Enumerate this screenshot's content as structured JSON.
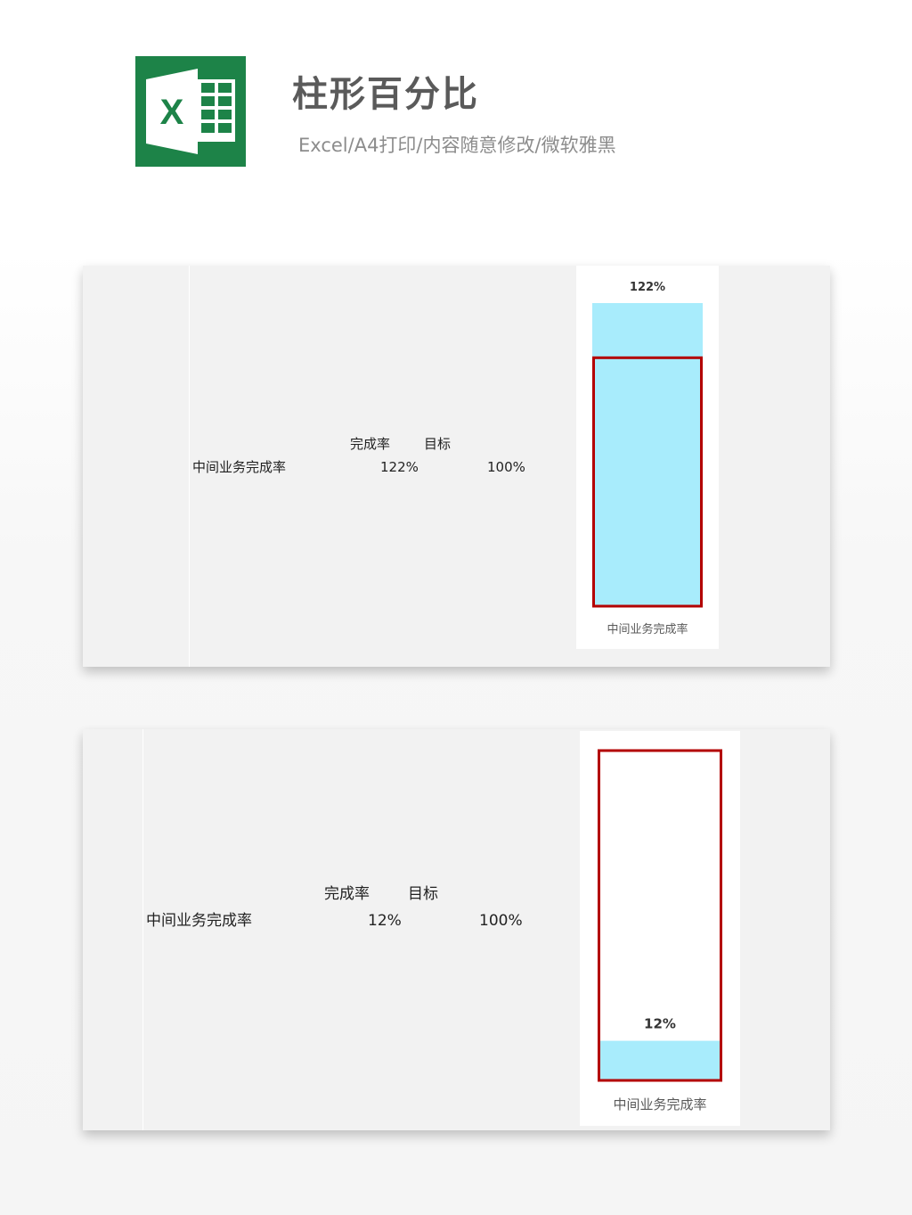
{
  "header": {
    "logo_letter": "X",
    "title": "柱形百分比",
    "subtitle": "Excel/A4打印/内容随意修改/微软雅黑"
  },
  "colors": {
    "excel_green": "#1d8348",
    "bar_fill": "#a8ecfc",
    "target_outline": "#b30000"
  },
  "sheets": [
    {
      "table": {
        "col_actual": "完成率",
        "col_target": "目标",
        "row_label": "中间业务完成率",
        "actual_value": "122%",
        "target_value": "100%"
      }
    },
    {
      "table": {
        "col_actual": "完成率",
        "col_target": "目标",
        "row_label": "中间业务完成率",
        "actual_value": "12%",
        "target_value": "100%"
      }
    }
  ],
  "chart_data": [
    {
      "type": "bar",
      "categories": [
        "中间业务完成率"
      ],
      "series": [
        {
          "values": [
            1.22
          ]
        },
        {
          "values": [
            1.0
          ]
        }
      ],
      "data_labels": [
        "122%"
      ],
      "ylim": [
        0,
        1.22
      ],
      "grid": false
    },
    {
      "type": "bar",
      "categories": [
        "中间业务完成率"
      ],
      "series": [
        {
          "values": [
            0.12
          ]
        },
        {
          "values": [
            1.0
          ]
        }
      ],
      "data_labels": [
        "12%"
      ],
      "ylim": [
        0,
        1.0
      ],
      "grid": false
    }
  ]
}
